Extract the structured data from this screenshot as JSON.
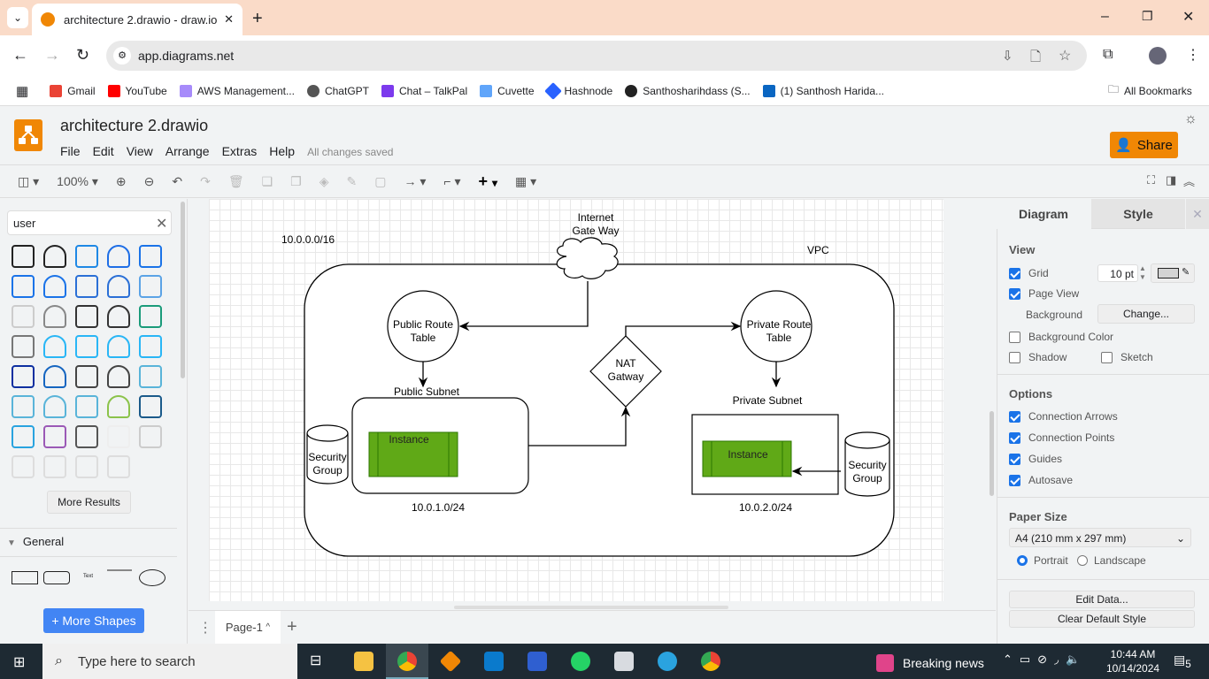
{
  "browser": {
    "tab_title": "architecture 2.drawio - draw.io",
    "url": "app.diagrams.net",
    "bookmarks": [
      "Gmail",
      "YouTube",
      "AWS Management...",
      "ChatGPT",
      "Chat – TalkPal",
      "Cuvette",
      "Hashnode",
      "Santhosharihdass (S...",
      "(1) Santhosh Harida..."
    ],
    "all_bookmarks": "All Bookmarks"
  },
  "app": {
    "doc_title": "architecture 2.drawio",
    "menu": [
      "File",
      "Edit",
      "View",
      "Arrange",
      "Extras",
      "Help"
    ],
    "save_status": "All changes saved",
    "share_label": "Share",
    "zoom": "100%",
    "brand_color": "#f08705"
  },
  "left_panel": {
    "search_value": "user",
    "more_results": "More Results",
    "section_general": "General",
    "more_shapes": "+ More Shapes"
  },
  "diagram": {
    "vpc_cidr": "10.0.0.0/16",
    "vpc_label": "VPC",
    "igw_label": [
      "Internet",
      "Gate Way"
    ],
    "public_rt": [
      "Public Route",
      "Table"
    ],
    "private_rt": [
      "Private Route",
      "Table"
    ],
    "nat": [
      "NAT",
      "Gatway"
    ],
    "public_subnet": "Public Subnet",
    "private_subnet": "Private Subnet",
    "instance": "Instance",
    "security_group": [
      "Security",
      "Group"
    ],
    "public_cidr": "10.0.1.0/24",
    "private_cidr": "10.0.2.0/24",
    "instance_color": "#60a917"
  },
  "page_tab": "Page-1",
  "right_panel": {
    "tabs": [
      "Diagram",
      "Style"
    ],
    "view_heading": "View",
    "grid": "Grid",
    "grid_size": "10 pt",
    "page_view": "Page View",
    "background": "Background",
    "change": "Change...",
    "background_color": "Background Color",
    "shadow": "Shadow",
    "sketch": "Sketch",
    "options_heading": "Options",
    "options": [
      "Connection Arrows",
      "Connection Points",
      "Guides",
      "Autosave"
    ],
    "paper_heading": "Paper Size",
    "paper_size": "A4 (210 mm x 297 mm)",
    "portrait": "Portrait",
    "landscape": "Landscape",
    "edit_data": "Edit Data...",
    "clear_style": "Clear Default Style"
  },
  "taskbar": {
    "search_placeholder": "Type here to search",
    "news": "Breaking news",
    "time": "10:44 AM",
    "date": "10/14/2024",
    "notifications": "5"
  }
}
